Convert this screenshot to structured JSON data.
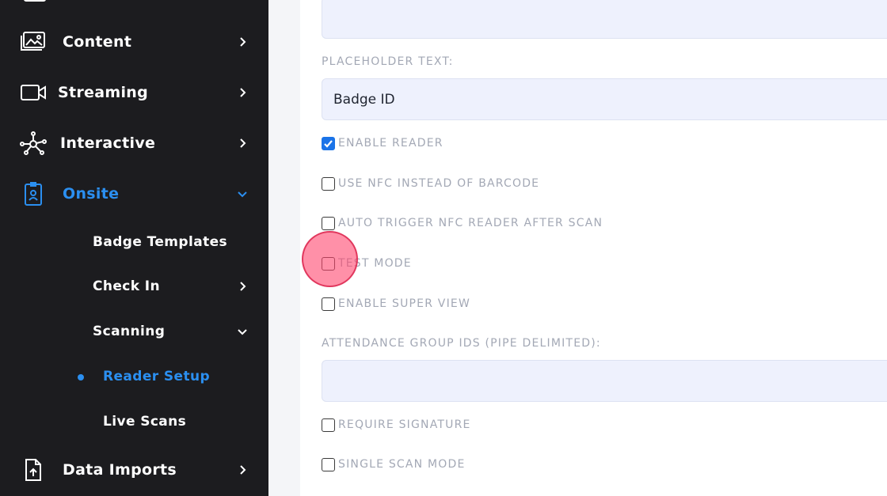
{
  "sidebar": {
    "items": [
      {
        "label": "Content",
        "icon": "image-gallery-icon"
      },
      {
        "label": "Streaming",
        "icon": "video-camera-icon"
      },
      {
        "label": "Interactive",
        "icon": "network-nodes-icon"
      },
      {
        "label": "Onsite",
        "icon": "id-badge-icon",
        "active": true,
        "expanded": true
      },
      {
        "label": "Data Imports",
        "icon": "file-upload-icon"
      }
    ],
    "onsite_children": [
      {
        "label": "Badge Templates"
      },
      {
        "label": "Check In",
        "expandable": true
      },
      {
        "label": "Scanning",
        "expanded": true
      }
    ],
    "scanning_children": [
      {
        "label": "Reader Setup",
        "active": true
      },
      {
        "label": "Live Scans"
      }
    ],
    "accent_color": "#2b8ff0"
  },
  "form": {
    "top_field_value": "",
    "placeholder_label": "PLACEHOLDER TEXT:",
    "placeholder_value": "Badge ID",
    "checkboxes_a": [
      {
        "label": "ENABLE READER",
        "checked": true
      },
      {
        "label": "USE NFC INSTEAD OF BARCODE",
        "checked": false
      },
      {
        "label": "AUTO TRIGGER NFC READER AFTER SCAN",
        "checked": false
      },
      {
        "label": "TEST MODE",
        "checked": false
      },
      {
        "label": "ENABLE SUPER VIEW",
        "checked": false
      }
    ],
    "attendance_label": "ATTENDANCE GROUP IDS (PIPE DELIMITED):",
    "attendance_value": "",
    "checkboxes_b": [
      {
        "label": "REQUIRE SIGNATURE",
        "checked": false
      },
      {
        "label": "SINGLE SCAN MODE",
        "checked": false
      }
    ]
  }
}
